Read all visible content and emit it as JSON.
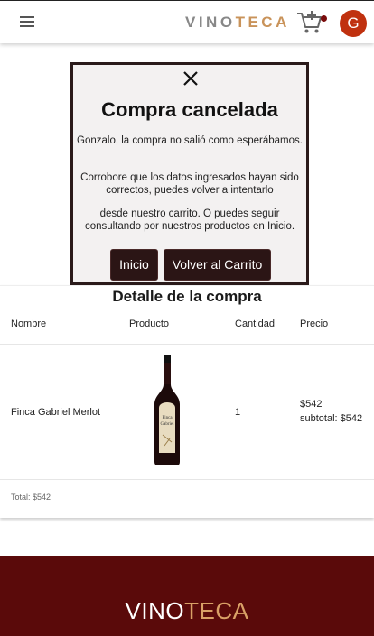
{
  "header": {
    "brand_part1": "VINO",
    "brand_part2": "TECA",
    "avatar_letter": "G",
    "menu_icon": "hamburger-menu-icon",
    "cart_icon": "add-to-cart-icon"
  },
  "modal": {
    "title": "Compra cancelada",
    "message_1": "Gonzalo, la compra no salió como esperábamos.",
    "message_2": "Corrobore que los datos ingresados hayan sido correctos, puedes volver a intentarlo",
    "message_3": "desde nuestro carrito. O puedes seguir consultando por nuestros productos en Inicio.",
    "button_home": "Inicio",
    "button_cart": "Volver al Carrito"
  },
  "detail": {
    "title": "Detalle de la compra",
    "columns": [
      "Nombre",
      "Producto",
      "Cantidad",
      "Precio"
    ],
    "items": [
      {
        "name": "Finca Gabriel Merlot",
        "quantity": "1",
        "price": "$542",
        "subtotal": "subtotal: $542"
      }
    ],
    "total": "Total: $542"
  },
  "footer": {
    "brand_part1": "VINO",
    "brand_part2": "TECA"
  },
  "colors": {
    "accent": "#c9935a",
    "footer_bg": "#5a0a0a",
    "avatar_bg": "#c0310f",
    "button_bg": "#2b1515"
  }
}
